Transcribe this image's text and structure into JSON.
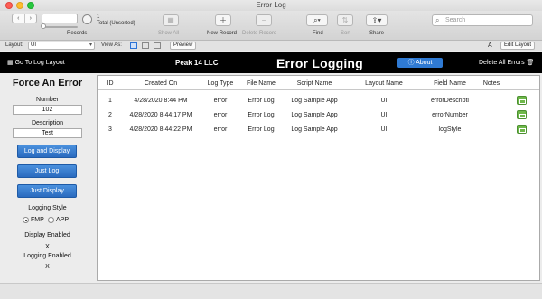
{
  "window": {
    "title": "Error Log"
  },
  "toolbar": {
    "record_value": "",
    "records_label": "Records",
    "total_label": "1",
    "total_sub": "Total (Unsorted)",
    "show_all": "Show All",
    "new_record": "New Record",
    "delete_record": "Delete Record",
    "find": "Find",
    "sort": "Sort",
    "share": "Share",
    "search_placeholder": "Search"
  },
  "layoutbar": {
    "layout_label": "Layout:",
    "layout_value": "UI",
    "view_as_label": "View As:",
    "preview": "Preview",
    "font_icon": "A",
    "edit_layout": "Edit Layout"
  },
  "header": {
    "go_to_log": "Go To Log Layout",
    "company": "Peak 14 LLC",
    "title": "Error Logging",
    "about": "About",
    "delete_all": "Delete All Errors"
  },
  "left": {
    "title": "Force An Error",
    "number_label": "Number",
    "number_value": "102",
    "description_label": "Description",
    "description_value": "Test",
    "btn_log_display": "Log and Display",
    "btn_just_log": "Just Log",
    "btn_just_display": "Just Display",
    "logging_style_label": "Logging Style",
    "radio_fmp": "FMP",
    "radio_app": "APP",
    "display_enabled_label": "Display Enabled",
    "display_enabled_mark": "X",
    "logging_enabled_label": "Logging Enabled",
    "logging_enabled_mark": "X"
  },
  "table": {
    "headers": [
      "ID",
      "Created On",
      "Log Type",
      "File Name",
      "Script Name",
      "Layout Name",
      "Field Name",
      "Notes"
    ],
    "rows": [
      [
        "1",
        "4/28/2020 8:44 PM",
        "error",
        "Error Log",
        "Log Sample App",
        "UI",
        "errorDescripti",
        ""
      ],
      [
        "2",
        "4/28/2020 8:44:17 PM",
        "error",
        "Error Log",
        "Log Sample App",
        "UI",
        "errorNumber",
        ""
      ],
      [
        "3",
        "4/28/2020 8:44:22 PM",
        "error",
        "Error Log",
        "Log Sample App",
        "UI",
        "logStyle",
        ""
      ]
    ]
  },
  "colors": {
    "accent": "#2f7ad3",
    "header_bg": "#000000",
    "row_button": "#6fb84a"
  }
}
